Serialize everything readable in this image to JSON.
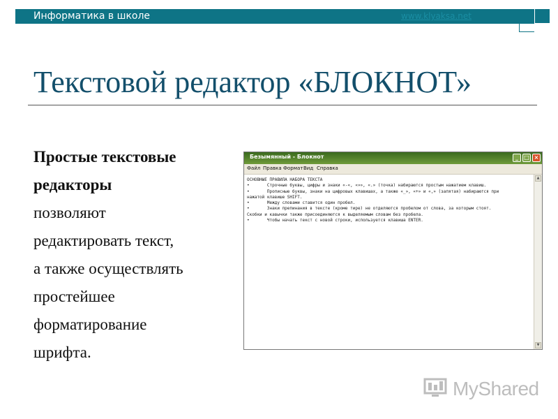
{
  "header": {
    "site_title": "Информатика в школе",
    "url": "www.klyaksa.net"
  },
  "slide": {
    "title": "Текстовой редактор «БЛОКНОТ»",
    "body_bold_lines": [
      "Простые текстовые",
      "редакторы"
    ],
    "body_lines": [
      "позволяют",
      "редактировать текст,",
      "а также осуществлять",
      "простейшее",
      "форматирование",
      "шрифта."
    ]
  },
  "notepad": {
    "window_title": "Безымянный - Блокнот",
    "menu": [
      "Файл",
      "Правка",
      "Формат",
      "Вид",
      "Справка"
    ],
    "content_lines": [
      "ОСНОВНЫЕ ПРАВИЛА НАБОРА ТЕКСТА",
      "",
      "•       Строчные буквы, цифры и знаки «-«, «»», «.» (точка) набираются простым нажатием клавиш.",
      "•       Прописные буквы, знаки на цифровых клавишах, а также «_», «+» и «,» (запятая) набираются при",
      "нажатой клавише SHIFT.",
      "•       Между словами ставится один пробел.",
      "•       Знаки препинания в тексте (кроме тире) не отделяются пробелом от слова, за которым стоят.",
      "Скобки и кавычки также присоединяются к выделяемым словам без пробела.",
      "•       Чтобы начать текст с новой строки, используется клавиша ENTER."
    ]
  },
  "watermark": {
    "text": "MyShared",
    "icon": "myshared-logo-icon"
  },
  "colors": {
    "banner": "#0e7486",
    "title": "#134f6b",
    "notepad_titlebar": "#4c7a28"
  }
}
